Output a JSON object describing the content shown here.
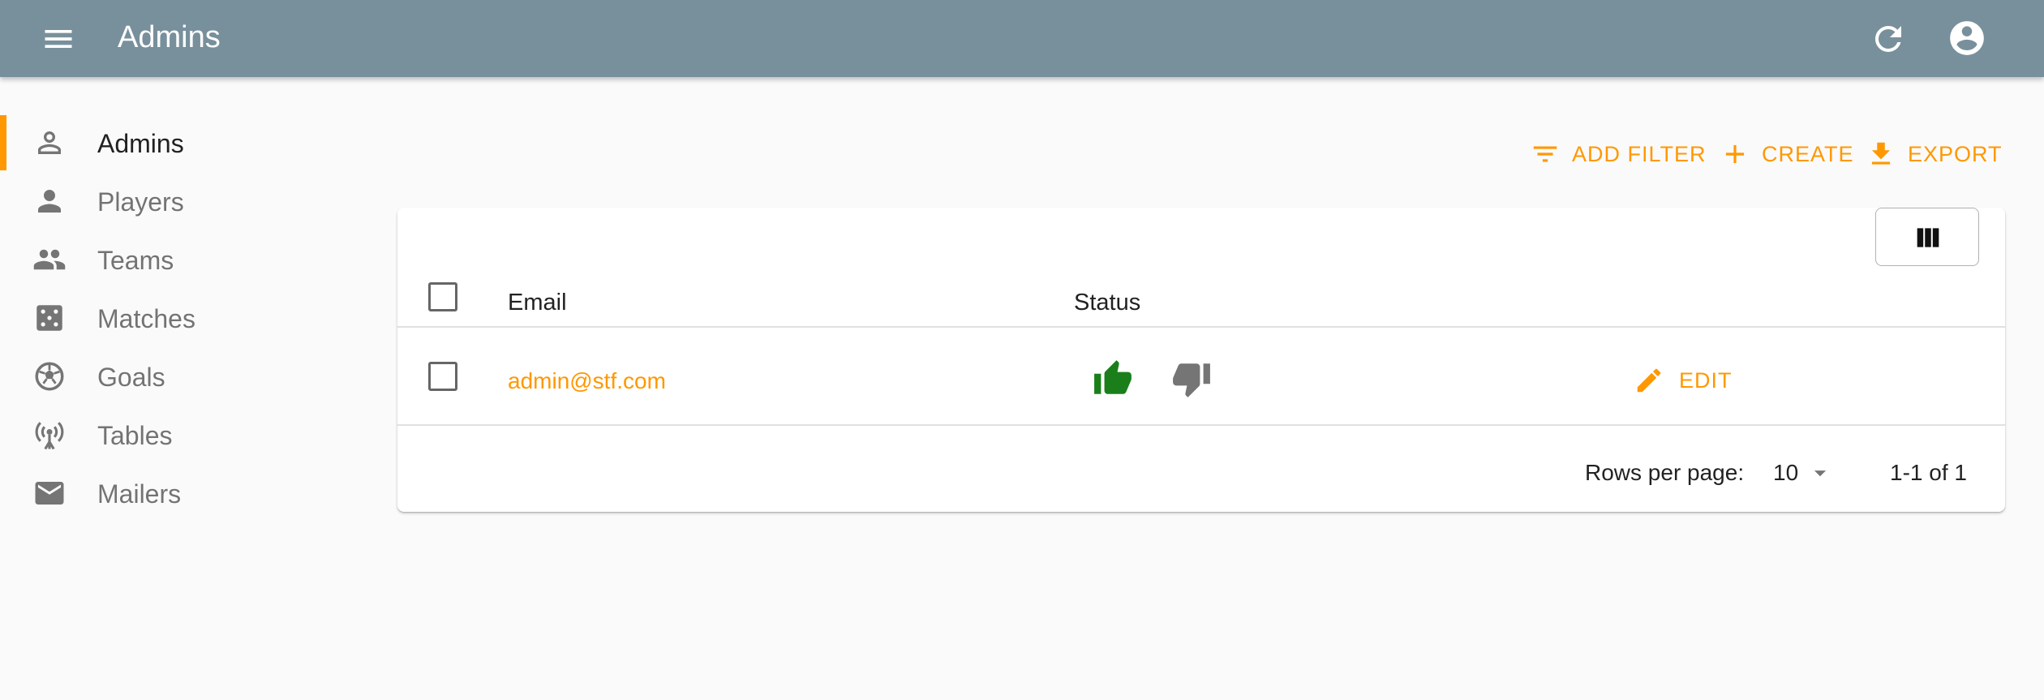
{
  "appbar": {
    "title": "Admins",
    "menu_icon": "hamburger-menu-icon",
    "refresh_icon": "refresh-icon",
    "account_icon": "account-circle-icon",
    "color": "#78909c"
  },
  "sidebar": {
    "items": [
      {
        "label": "Admins",
        "icon": "person-outline-icon",
        "active": true
      },
      {
        "label": "Players",
        "icon": "person-icon",
        "active": false
      },
      {
        "label": "Teams",
        "icon": "people-icon",
        "active": false
      },
      {
        "label": "Matches",
        "icon": "dice-icon",
        "active": false
      },
      {
        "label": "Goals",
        "icon": "soccer-ball-icon",
        "active": false
      },
      {
        "label": "Tables",
        "icon": "antenna-icon",
        "active": false
      },
      {
        "label": "Mailers",
        "icon": "mail-icon",
        "active": false
      }
    ],
    "accent": "#ff9800"
  },
  "toolbar": {
    "add_filter_label": "ADD FILTER",
    "create_label": "CREATE",
    "export_label": "EXPORT"
  },
  "table": {
    "columns_icon": "view-column-icon",
    "headers": {
      "email": "Email",
      "status": "Status"
    },
    "rows": [
      {
        "email": "admin@stf.com",
        "status_up_color": "#1a7f1a",
        "status_down_color": "#757575",
        "edit_label": "EDIT"
      }
    ],
    "pagination": {
      "rows_per_page_label": "Rows per page:",
      "rows_per_page_value": "10",
      "range": "1-1 of 1"
    }
  }
}
